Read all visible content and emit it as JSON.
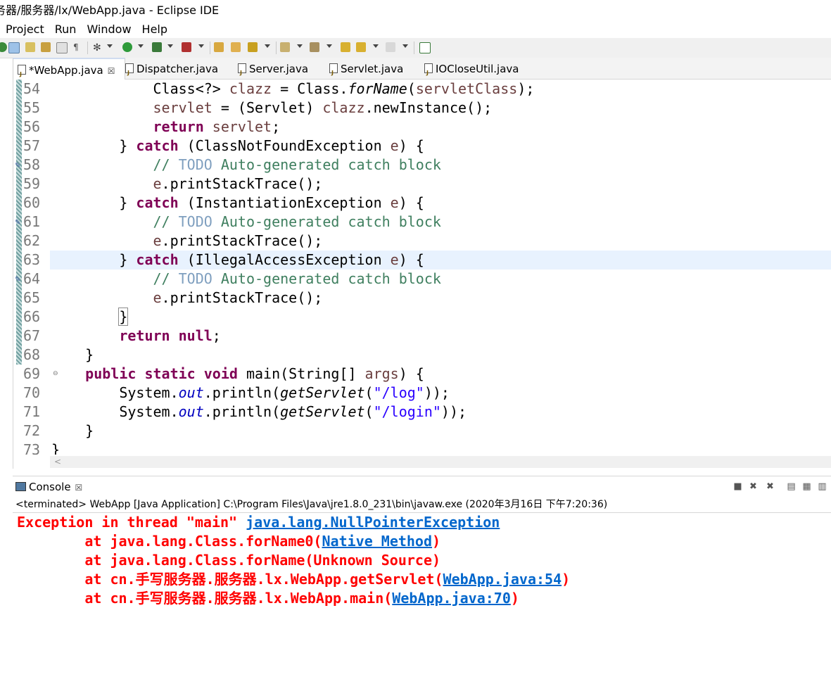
{
  "window": {
    "title": "务器/服务器/lx/WebApp.java - Eclipse IDE"
  },
  "menu": [
    "Project",
    "Run",
    "Window",
    "Help"
  ],
  "tabs": [
    {
      "label": "*WebApp.java",
      "active": true,
      "closable": true
    },
    {
      "label": "Dispatcher.java"
    },
    {
      "label": "Server.java"
    },
    {
      "label": "Servlet.java"
    },
    {
      "label": "IOCloseUtil.java"
    }
  ],
  "editor": {
    "line_numbers": [
      "54",
      "55",
      "56",
      "57",
      "58",
      "59",
      "60",
      "61",
      "62",
      "63",
      "64",
      "65",
      "66",
      "67",
      "68",
      "69",
      "70",
      "71",
      "72",
      "73"
    ],
    "code": {
      "l54": {
        "indent": "            ",
        "a": "Class<?> ",
        "b": "clazz",
        "c": " = Class.",
        "d": "forName",
        "e": "(",
        "f": "servletClass",
        "g": ");"
      },
      "l55": {
        "indent": "            ",
        "a": "servlet",
        "b": " = (Servlet) ",
        "c": "clazz",
        "d": ".newInstance();"
      },
      "l56": {
        "indent": "            ",
        "kw": "return",
        "a": " ",
        "b": "servlet",
        "c": ";"
      },
      "l57": {
        "indent": "        ",
        "a": "} ",
        "kw": "catch",
        "b": " (ClassNotFoundException ",
        "c": "e",
        "d": ") {"
      },
      "l58": {
        "indent": "            ",
        "a": "// ",
        "todo": "TODO",
        "b": " Auto-generated catch block"
      },
      "l59": {
        "indent": "            ",
        "a": "e",
        "b": ".printStackTrace();"
      },
      "l60": {
        "indent": "        ",
        "a": "} ",
        "kw": "catch",
        "b": " (InstantiationException ",
        "c": "e",
        "d": ") {"
      },
      "l61": {
        "indent": "            ",
        "a": "// ",
        "todo": "TODO",
        "b": " Auto-generated catch block"
      },
      "l62": {
        "indent": "            ",
        "a": "e",
        "b": ".printStackTrace();"
      },
      "l63": {
        "indent": "        ",
        "a": "} ",
        "kw": "catch",
        "b": " (IllegalAccessException ",
        "c": "e",
        "d": ") {"
      },
      "l64": {
        "indent": "            ",
        "a": "// ",
        "todo": "TODO",
        "b": " Auto-generated catch block"
      },
      "l65": {
        "indent": "            ",
        "a": "e",
        "b": ".printStackTrace();"
      },
      "l66": {
        "indent": "        ",
        "a": "}"
      },
      "l67": {
        "indent": "        ",
        "kw": "return",
        "a": " ",
        "kw2": "null",
        "b": ";"
      },
      "l68": {
        "indent": "    ",
        "a": "}"
      },
      "l69": {
        "indent": "    ",
        "kw": "public static void",
        "a": " main(String[] ",
        "b": "args",
        "c": ") {"
      },
      "l70": {
        "indent": "        ",
        "a": "System.",
        "b": "out",
        "c": ".println(",
        "d": "getServlet",
        "e": "(",
        "f": "\"/log\"",
        "g": "));"
      },
      "l71": {
        "indent": "        ",
        "a": "System.",
        "b": "out",
        "c": ".println(",
        "d": "getServlet",
        "e": "(",
        "f": "\"/login\"",
        "g": "));"
      },
      "l72": {
        "indent": "    ",
        "a": "}"
      },
      "l73": {
        "indent": "",
        "a": "}"
      }
    }
  },
  "console": {
    "tab_label": "Console",
    "status": "<terminated> WebApp [Java Application] C:\\Program Files\\Java\\jre1.8.0_231\\bin\\javaw.exe (2020年3月16日 下午7:20:36)",
    "lines": {
      "e1": {
        "a": "Exception in thread \"main\" ",
        "link": "java.lang.NullPointerException"
      },
      "e2": {
        "a": "        at java.lang.Class.forName0(",
        "link": "Native Method",
        "b": ")"
      },
      "e3": {
        "a": "        at java.lang.Class.forName(Unknown Source)"
      },
      "e4": {
        "a": "        at cn.手写服务器.服务器.lx.WebApp.getServlet(",
        "link": "WebApp.java:54",
        "b": ")"
      },
      "e5": {
        "a": "        at cn.手写服务器.服务器.lx.WebApp.main(",
        "link": "WebApp.java:70",
        "b": ")"
      }
    }
  }
}
